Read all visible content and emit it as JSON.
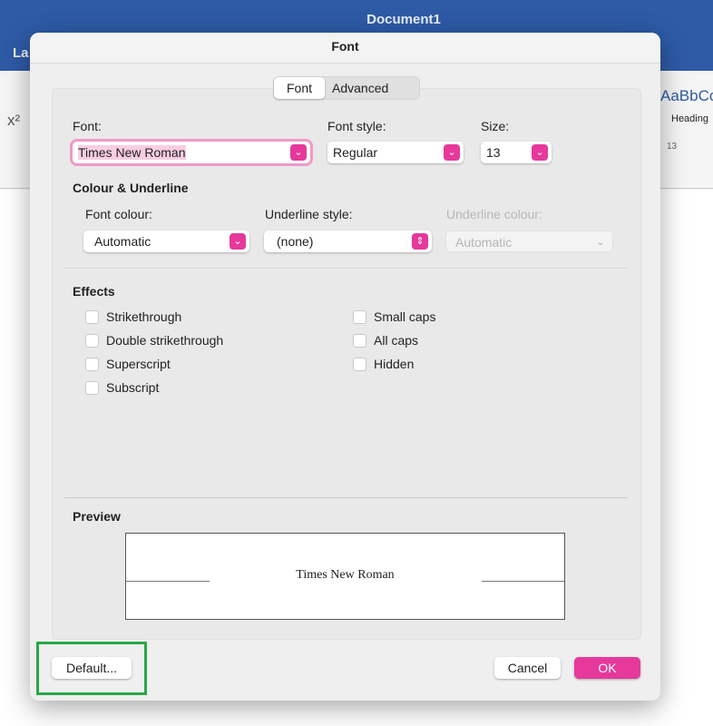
{
  "app": {
    "title": "Document1",
    "tab_partial": "La",
    "ribbon_sup": "x²",
    "style_preview": "AaBbCc",
    "style_name": "Heading",
    "ruler_mark": "13"
  },
  "dialog": {
    "title": "Font",
    "tabs": [
      "Font",
      "Advanced"
    ],
    "active_tab": "Font"
  },
  "font": {
    "font_label": "Font:",
    "font_value": "Times New Roman",
    "style_label": "Font style:",
    "style_value": "Regular",
    "size_label": "Size:",
    "size_value": "13"
  },
  "colour": {
    "heading": "Colour & Underline",
    "font_colour_label": "Font colour:",
    "font_colour_value": "Automatic",
    "underline_style_label": "Underline style:",
    "underline_style_value": "(none)",
    "underline_colour_label": "Underline colour:",
    "underline_colour_value": "Automatic"
  },
  "effects": {
    "heading": "Effects",
    "left": [
      "Strikethrough",
      "Double strikethrough",
      "Superscript",
      "Subscript"
    ],
    "right": [
      "Small caps",
      "All caps",
      "Hidden"
    ]
  },
  "preview": {
    "heading": "Preview",
    "text": "Times New Roman"
  },
  "buttons": {
    "default": "Default...",
    "cancel": "Cancel",
    "ok": "OK"
  },
  "colors": {
    "accent": "#e6399b",
    "titlebar": "#2e5aa6",
    "highlight": "#29a847"
  }
}
